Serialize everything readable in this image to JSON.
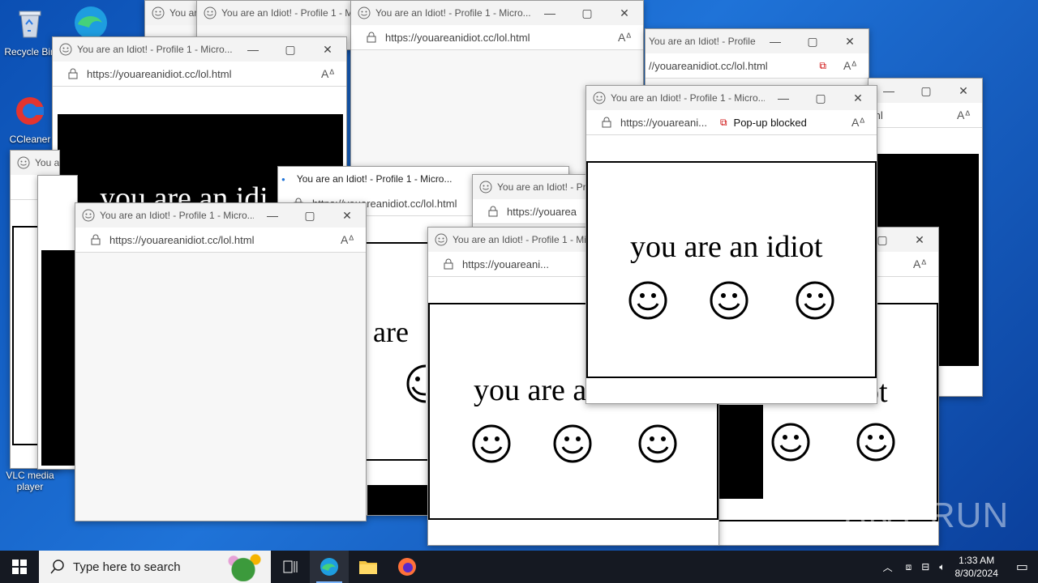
{
  "desktop": {
    "icons": [
      {
        "label": "Recycle Bin"
      },
      {
        "label": "CCleaner"
      },
      {
        "label": "VLC media player"
      }
    ]
  },
  "browser": {
    "title": "You are an Idiot! - Profile 1 - Micro...",
    "title_short": "You are an Idiot! - Prof",
    "url_full": "https://youareanidiot.cc/lol.html",
    "url_host": "youareanidiot.cc",
    "url_prefix": "https://",
    "url_path": "/lol.html",
    "url_truncated": "https://youareani...",
    "url_partial": "//youareanidiot.cc/lol.html",
    "url_tail": "ml",
    "url_short": "https://youarea",
    "popup_blocked": "Pop-up blocked",
    "content_text": "you are an idiot",
    "content_partial_1": "you are an idi",
    "content_partial_2": "u are",
    "content_partial_3": "you are a",
    "content_partial_4": "ot",
    "tab_prefix": "You are",
    "tab_prefix_2": "You a"
  },
  "taskbar": {
    "search_placeholder": "Type here to search",
    "time": "1:33 AM",
    "date": "8/30/2024"
  },
  "watermark": "ANY RUN"
}
